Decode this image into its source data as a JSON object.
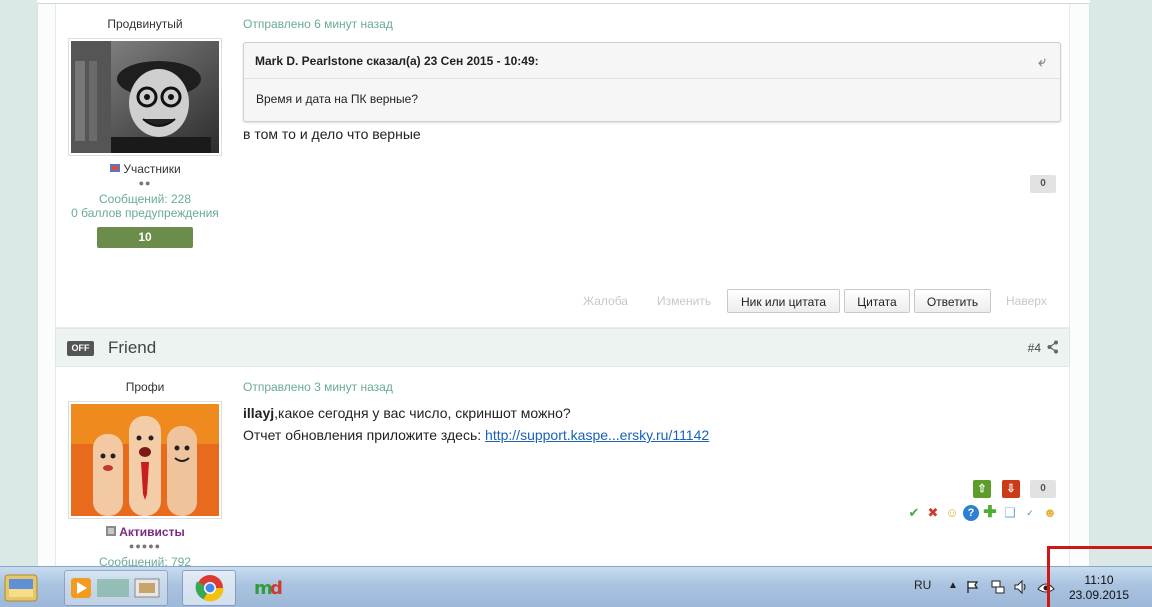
{
  "post1": {
    "rank": "Продвинутый",
    "group": "Участники",
    "pips": "●●",
    "messages": "Сообщений: 228",
    "warnings": "0 баллов предупреждения",
    "reputation": "10",
    "posted": "Отправлено 6 минут назад",
    "quote_header": "Mark D. Pearlstone сказал(а) 23 Сен 2015 - 10:49:",
    "quote_body": "Время и дата на ПК верные?",
    "message": "в том то и дело что верные",
    "vote_count": "0",
    "actions": {
      "report": "Жалоба",
      "edit": "Изменить",
      "nick_or_quote": "Ник или цитата",
      "quote": "Цитата",
      "reply": "Ответить",
      "top": "Наверх"
    }
  },
  "post2_bar": {
    "status_badge": "OFF",
    "author_name": "Friend",
    "post_number": "#4"
  },
  "post2": {
    "rank": "Профи",
    "group": "Активисты",
    "pips": "●●●●●",
    "messages": "Сообщений: 792",
    "posted": "Отправлено 3 минут назад",
    "mention": "illayj",
    "line1": ",какое сегодня у вас число, скриншот можно?",
    "line2_prefix": "Отчет обновления приложите здесь: ",
    "link": "http://support.kaspe...ersky.ru/11142",
    "vote_count": "0"
  },
  "taskbar": {
    "lang": "RU",
    "time": "11:10",
    "date": "23.09.2015"
  },
  "colors": {
    "accent_teal": "#6aaa9a",
    "rep_green": "#6b8c4b",
    "vote_up": "#5e9d2a",
    "vote_down": "#cc3b17",
    "highlight": "#d11616"
  }
}
